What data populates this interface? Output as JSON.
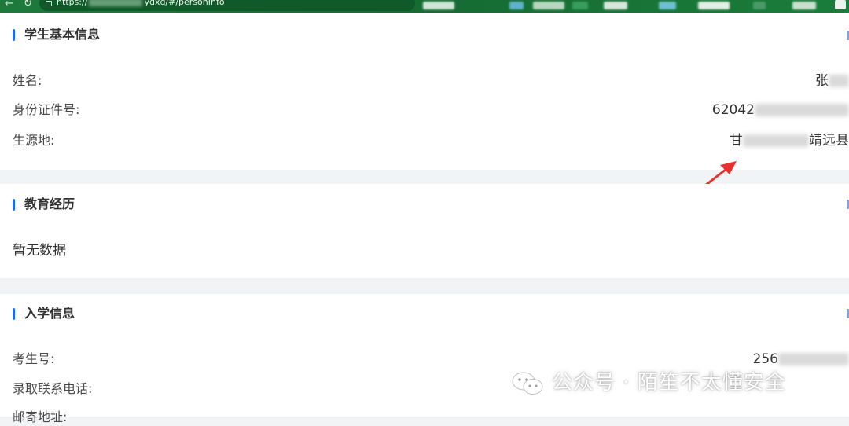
{
  "browser": {
    "url_prefix": "https://",
    "url_suffix": "ydxg/#/personInfo"
  },
  "sections": {
    "basic": {
      "title": "学生基本信息",
      "rows": [
        {
          "label": "姓名:",
          "value": "张"
        },
        {
          "label": "身份证件号:",
          "value": "62042"
        },
        {
          "label": "生源地:",
          "value_prefix": "甘",
          "value_suffix": "靖远县"
        }
      ]
    },
    "education": {
      "title": "教育经历",
      "empty_text": "暂无数据"
    },
    "enrollment": {
      "title": "入学信息",
      "rows": [
        {
          "label": "考生号:",
          "value": "256"
        },
        {
          "label": "录取联系电话:",
          "value": ""
        },
        {
          "label": "邮寄地址:",
          "value": ""
        }
      ]
    }
  },
  "watermark": {
    "text": "公众号 · 陌笙不太懂安全"
  },
  "colors": {
    "accent": "#1f6bef",
    "browser_bar": "#1e7a3c",
    "arrow": "#e8322f",
    "page_bg": "#f2f3f5"
  },
  "icons": [
    "back-arrow-icon",
    "reload-icon",
    "lock-icon",
    "extension-icon",
    "wechat-icon"
  ]
}
